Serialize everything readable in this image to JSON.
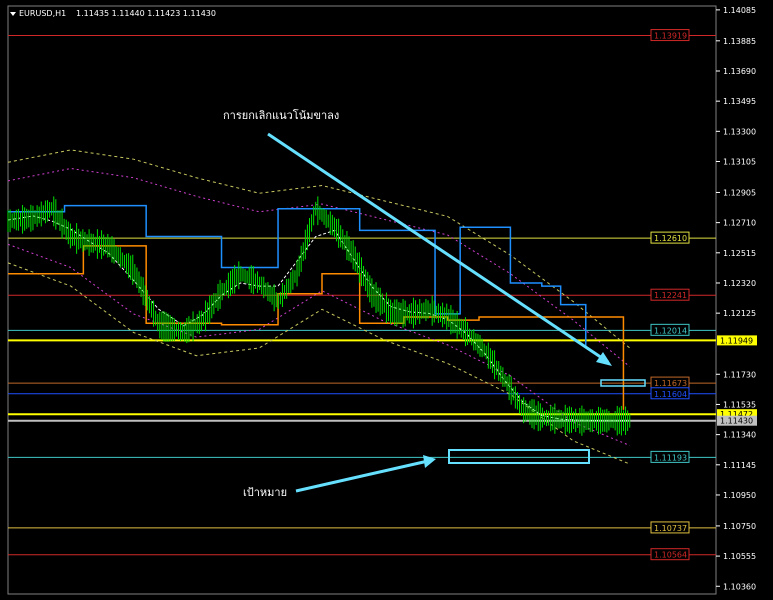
{
  "header": {
    "symbol": "EURUSD,H1",
    "ohlc": "1.11435 1.11440 1.11423 1.11430",
    "menu_icon": "triangle-down-icon"
  },
  "colors": {
    "background": "#000000",
    "candles": "#00e000",
    "axis_text": "#ffffff",
    "annotation_arrow": "#66e0ff",
    "upper_band": "#c8c860",
    "donchian_upper": "#1e90ff",
    "donchian_lower": "#ff8c00"
  },
  "chart_data": {
    "type": "line",
    "title": "EURUSD,H1 1.11435 1.11440 1.11423 1.11430",
    "y_axis": {
      "position": "right",
      "ylim": [
        1.1031,
        1.1411
      ],
      "ticks": [
        "1.14085",
        "1.13885",
        "1.13690",
        "1.13495",
        "1.13300",
        "1.13105",
        "1.12905",
        "1.12710",
        "1.12515",
        "1.12320",
        "1.12125",
        "1.11730",
        "1.11535",
        "1.11340",
        "1.11145",
        "1.10950",
        "1.10750",
        "1.10555",
        "1.10360"
      ]
    },
    "x_range": [
      0,
      100
    ],
    "price_series": {
      "name": "",
      "x": [
        0,
        4,
        7,
        10,
        13,
        16,
        20,
        24,
        28,
        31,
        34,
        37,
        40,
        43,
        46,
        49,
        52,
        55,
        58,
        61,
        64,
        67,
        70,
        73,
        76,
        79,
        82,
        85,
        88,
        91,
        94,
        97,
        99
      ],
      "y": [
        1.1272,
        1.1274,
        1.128,
        1.1262,
        1.1258,
        1.1256,
        1.124,
        1.1205,
        1.12,
        1.1208,
        1.1226,
        1.1238,
        1.1232,
        1.122,
        1.1238,
        1.128,
        1.1268,
        1.125,
        1.1225,
        1.1213,
        1.1212,
        1.1215,
        1.121,
        1.12,
        1.1188,
        1.117,
        1.115,
        1.1145,
        1.1144,
        1.1143,
        1.1143,
        1.1143,
        1.1143
      ]
    },
    "horizontal_levels": [
      {
        "label": "1.13919",
        "value": 1.13919,
        "color": "#d02828",
        "labeled": true
      },
      {
        "label": "1.12610",
        "value": 1.1261,
        "color": "#e0e040",
        "labeled": true
      },
      {
        "label": "1.12241",
        "value": 1.12241,
        "color": "#d02828",
        "labeled": true
      },
      {
        "label": "1.12014",
        "value": 1.12014,
        "color": "#40c8c8",
        "labeled": true
      },
      {
        "label": "1.11949",
        "value": 1.11949,
        "color": "#ffff00",
        "labeled": true,
        "highlight": true
      },
      {
        "label": "1.11673",
        "value": 1.11673,
        "color": "#c06828",
        "labeled": true
      },
      {
        "label": "1.11604",
        "value": 1.11604,
        "color": "#2050ff",
        "labeled": true
      },
      {
        "label": "1.11472",
        "value": 1.11472,
        "color": "#ffff00",
        "labeled": true,
        "highlight": true
      },
      {
        "label": "1.11430",
        "value": 1.1143,
        "color": "#c0c0c0",
        "labeled": true,
        "highlight": true
      },
      {
        "label": "1.11193",
        "value": 1.11193,
        "color": "#40c8c8",
        "labeled": true
      },
      {
        "label": "1.10737",
        "value": 1.10737,
        "color": "#e0c040",
        "labeled": true
      },
      {
        "label": "1.10564",
        "value": 1.10564,
        "color": "#d02828",
        "labeled": true
      }
    ],
    "donchian_upper": {
      "x": [
        0,
        9,
        22,
        34,
        43,
        56,
        68,
        72,
        78,
        80,
        85,
        88,
        92
      ],
      "y": [
        1.1278,
        1.1282,
        1.1262,
        1.1242,
        1.128,
        1.1266,
        1.1212,
        1.1268,
        1.1268,
        1.1232,
        1.123,
        1.1218,
        1.119
      ]
    },
    "donchian_lower": {
      "x": [
        0,
        12,
        22,
        34,
        43,
        50,
        56,
        63,
        70,
        75,
        80,
        92,
        98
      ],
      "y": [
        1.1238,
        1.1256,
        1.1206,
        1.1205,
        1.1225,
        1.1238,
        1.1206,
        1.121,
        1.1208,
        1.121,
        1.121,
        1.121,
        1.115
      ]
    },
    "band_upper": {
      "x": [
        0,
        10,
        20,
        30,
        40,
        50,
        60,
        70,
        80,
        90,
        99
      ],
      "y": [
        1.131,
        1.1318,
        1.1312,
        1.13,
        1.129,
        1.1295,
        1.1285,
        1.1275,
        1.125,
        1.122,
        1.119
      ]
    },
    "band_lower": {
      "x": [
        0,
        10,
        20,
        30,
        40,
        50,
        60,
        70,
        80,
        90,
        99
      ],
      "y": [
        1.1245,
        1.123,
        1.12,
        1.1185,
        1.119,
        1.1215,
        1.1195,
        1.118,
        1.116,
        1.113,
        1.1115
      ]
    },
    "annotations": [
      {
        "text": "การยกเลิกแนวโน้มขาลง",
        "arrow": "down-right"
      },
      {
        "text": "เป้าหมาย",
        "arrow": "up-right"
      }
    ]
  }
}
